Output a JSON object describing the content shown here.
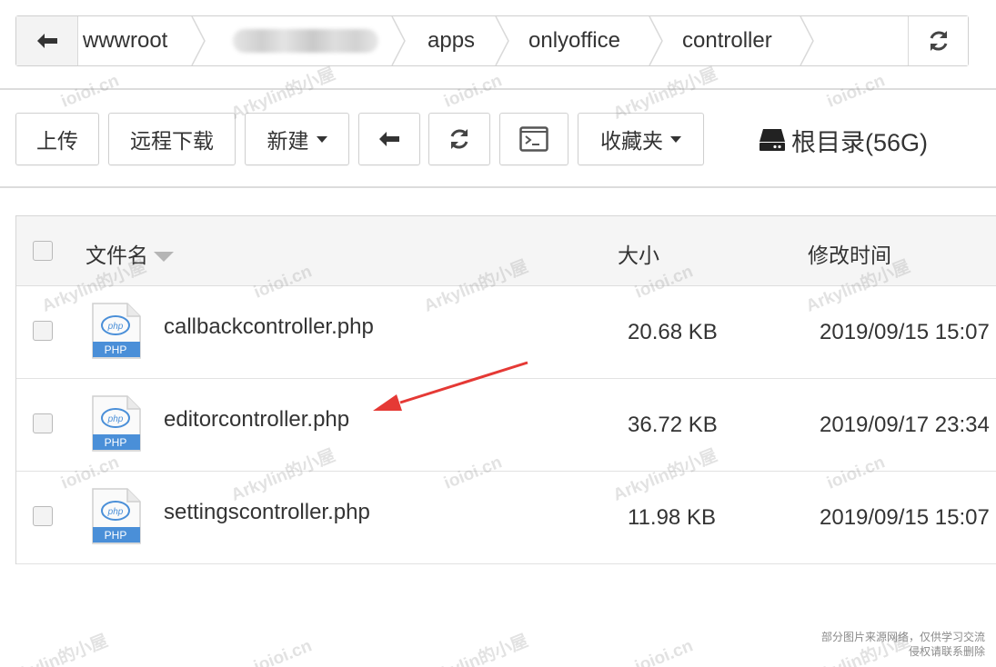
{
  "breadcrumb": {
    "items": [
      "wwwroot",
      "apps",
      "onlyoffice",
      "controller"
    ]
  },
  "toolbar": {
    "upload_label": "上传",
    "remote_download_label": "远程下载",
    "new_label": "新建",
    "favorites_label": "收藏夹",
    "root_label": "根目录(56G)"
  },
  "table": {
    "columns": [
      "文件名",
      "大小",
      "修改时间"
    ],
    "rows": [
      {
        "name": "callbackcontroller.php",
        "size": "20.68 KB",
        "modified": "2019/09/15 15:07"
      },
      {
        "name": "editorcontroller.php",
        "size": "36.72 KB",
        "modified": "2019/09/17 23:34"
      },
      {
        "name": "settingscontroller.php",
        "size": "11.98 KB",
        "modified": "2019/09/15 15:07"
      }
    ],
    "file_icon_badge": "PHP"
  },
  "watermarks": {
    "site": "ioioi.cn",
    "blog": "Arkylin的小屋"
  },
  "footer_note": {
    "line1": "部分图片来源网络，仅供学习交流",
    "line2": "侵权请联系删除"
  },
  "colors": {
    "php_badge": "#4a8fd8",
    "annotation_arrow": "#e53935"
  }
}
